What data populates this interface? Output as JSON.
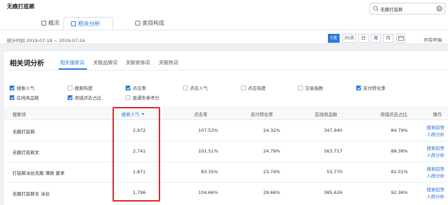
{
  "app": {
    "title": "无痕打底裤"
  },
  "search": {
    "value": "无痕打底裤"
  },
  "tabs": [
    {
      "label": "概况",
      "active": false
    },
    {
      "label": "相关分析",
      "active": true
    },
    {
      "label": "类目构成",
      "active": false
    }
  ],
  "date_label": "统计时间 2019-07-18 ~ 2019-07-24",
  "ranges": [
    {
      "label": "7天",
      "active": true
    },
    {
      "label": "30天",
      "active": false
    },
    {
      "label": "日",
      "active": false
    },
    {
      "label": "周",
      "active": false
    },
    {
      "label": "月",
      "active": false
    }
  ],
  "terminal": "所有终端",
  "section_title": "相关词分析",
  "subtabs": [
    {
      "label": "相关搜索词",
      "active": true
    },
    {
      "label": "关联品牌词",
      "active": false
    },
    {
      "label": "关联修饰词",
      "active": false
    },
    {
      "label": "关联热词",
      "active": false
    }
  ],
  "metrics": [
    {
      "label": "搜索人气",
      "checked": true
    },
    {
      "label": "搜索热度",
      "checked": false
    },
    {
      "label": "点击率",
      "checked": true
    },
    {
      "label": "点击人气",
      "checked": false
    },
    {
      "label": "点击热度",
      "checked": false
    },
    {
      "label": "交易指数",
      "checked": false
    },
    {
      "label": "支付转化率",
      "checked": true
    },
    {
      "label": "在线商品数",
      "checked": true
    },
    {
      "label": "商城点击占比",
      "checked": true
    },
    {
      "label": "直通车参考价",
      "checked": false
    }
  ],
  "columns": [
    "搜索词",
    "搜索人气",
    "点击率",
    "支付转化率",
    "在线商品数",
    "商城点击占比",
    "操作"
  ],
  "rows": [
    {
      "keyword": "无痕打底裤",
      "popularity": "2,972",
      "ctr": "107.53%",
      "conversion": "24.32%",
      "online": "347,940",
      "mall_ratio": "84.79%"
    },
    {
      "keyword": "无痕打底裤女",
      "popularity": "2,741",
      "ctr": "101.51%",
      "conversion": "24.79%",
      "online": "563,717",
      "mall_ratio": "88.38%"
    },
    {
      "keyword": "打底裤冰丝无痕 薄款 夏季",
      "popularity": "1,871",
      "ctr": "83.35%",
      "conversion": "23.74%",
      "online": "53,770",
      "mall_ratio": "82.01%"
    },
    {
      "keyword": "无痕打底裤女 冰丝",
      "popularity": "1,796",
      "ctr": "104.66%",
      "conversion": "29.66%",
      "online": "385,626",
      "mall_ratio": "92.36%"
    }
  ],
  "actions": {
    "trend": "搜索趋势",
    "crowd": "人群分析"
  },
  "colors": {
    "accent": "#2d7bd8",
    "highlight": "#d42a2a"
  }
}
